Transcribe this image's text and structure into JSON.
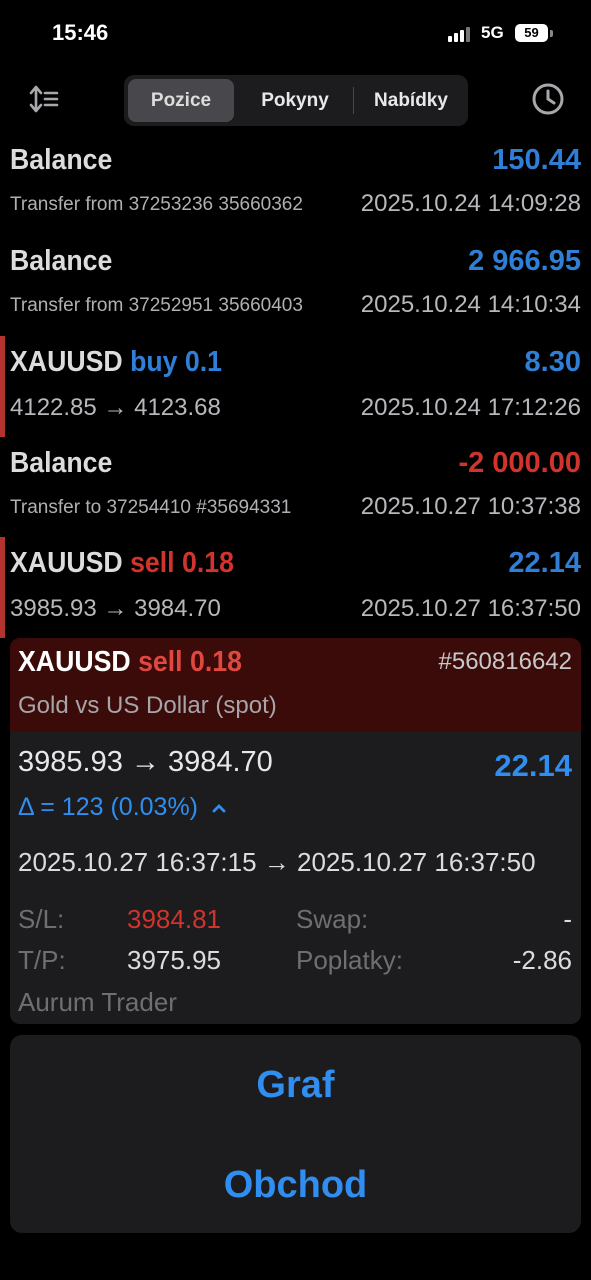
{
  "status_bar": {
    "time": "15:46",
    "network": "5G",
    "battery": "59"
  },
  "nav": {
    "tabs": [
      {
        "label": "Pozice"
      },
      {
        "label": "Pokyny"
      },
      {
        "label": "Nabídky"
      }
    ],
    "active_tab": "Pozice"
  },
  "deals": [
    {
      "title": "Balance",
      "amount": "150.44",
      "amount_color": "#2f7fd6",
      "sub": "Transfer from 37253236 35660362",
      "time": "2025.10.24 14:09:28"
    },
    {
      "title": "Balance",
      "amount": "2 966.95",
      "amount_color": "#2f7fd6",
      "sub": "Transfer from 37252951 35660403",
      "time": "2025.10.24 14:10:34"
    },
    {
      "symbol": "XAUUSD",
      "side": "buy 0.1",
      "amount": "8.30",
      "amount_color": "#2f7fd6",
      "sub": "4122.85 → 4123.68",
      "time": "2025.10.24 17:12:26"
    },
    {
      "title": "Balance",
      "amount": "-2 000.00",
      "amount_color": "#d0342c",
      "sub": "Transfer to 37254410 #35694331",
      "time": "2025.10.27 10:37:38"
    },
    {
      "symbol": "XAUUSD",
      "side": "sell 0.18",
      "amount": "22.14",
      "amount_color": "#2f7fd6",
      "sub": "3985.93 → 3984.70",
      "time": "2025.10.27 16:37:50"
    }
  ],
  "detail": {
    "symbol": "XAUUSD",
    "side": "sell 0.18",
    "ticket": "#560816642",
    "description": "Gold vs US Dollar (spot)",
    "prices": "3985.93 → 3984.70",
    "profit": "22.14",
    "delta": "Δ = 123 (0.03%)",
    "times": "2025.10.27 16:37:15 → 2025.10.27 16:37:50",
    "sl_label": "S/L:",
    "sl_value": "3984.81",
    "tp_label": "T/P:",
    "tp_value": "3975.95",
    "swap_label": "Swap:",
    "swap_value": "-",
    "fees_label": "Poplatky:",
    "fees_value": "-2.86",
    "comment": "Aurum Trader"
  },
  "actions": {
    "chart": "Graf",
    "trade": "Obchod"
  },
  "colors": {
    "accent_blue": "#2f8ef0",
    "loss_red": "#d0342c",
    "sell_header_bg": "#3a0b08"
  }
}
